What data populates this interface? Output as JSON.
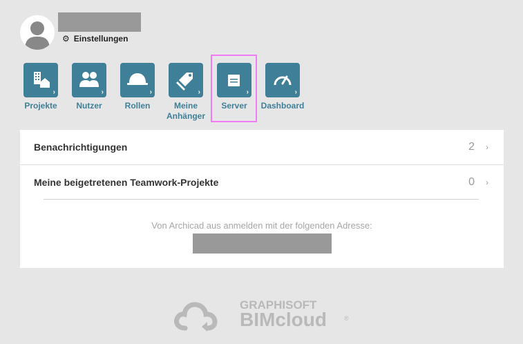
{
  "user": {
    "settings_label": "Einstellungen"
  },
  "nav": {
    "tiles": [
      {
        "label": "Projekte",
        "icon": "projects-icon"
      },
      {
        "label": "Nutzer",
        "icon": "users-icon"
      },
      {
        "label": "Rollen",
        "icon": "hard-hat-icon"
      },
      {
        "label": "Meine Anhänger",
        "label_line1": "Meine",
        "label_line2": "Anhänger",
        "icon": "tags-icon"
      },
      {
        "label": "Server",
        "icon": "server-icon"
      },
      {
        "label": "Dashboard",
        "icon": "gauge-icon"
      }
    ],
    "highlighted": "Server"
  },
  "panel": {
    "notifications": {
      "label": "Benachrichtigungen",
      "count": "2"
    },
    "teamwork": {
      "label": "Meine beigetretenen Teamwork-Projekte",
      "count": "0"
    },
    "login_hint": "Von Archicad aus anmelden mit der folgenden Adresse:"
  },
  "brand": {
    "top": "GRAPHISOFT",
    "main": "BIMcloud",
    "registered": "®"
  },
  "colors": {
    "background": "#e6e6e6",
    "tile": "#3f7f97",
    "highlight": "#f07bf5",
    "redaction": "#999999"
  }
}
